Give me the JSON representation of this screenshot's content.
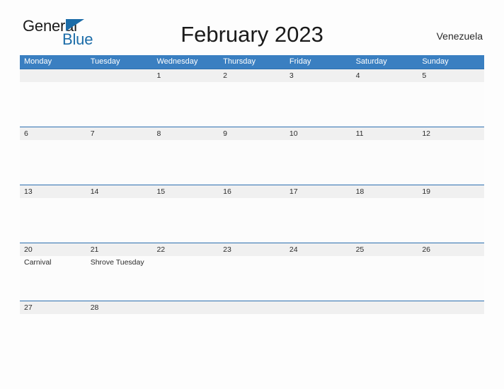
{
  "brand": {
    "name_part1": "General",
    "name_part2": "Blue",
    "flag_icon": "blue-triangle-flag-icon",
    "color_primary": "#1b6ca8"
  },
  "header": {
    "title": "February 2023",
    "country": "Venezuela"
  },
  "calendar": {
    "header_color": "#3a7fc1",
    "row_line_color": "#2c6fb0",
    "band_color": "#f0f0f0",
    "weekdays": [
      "Monday",
      "Tuesday",
      "Wednesday",
      "Thursday",
      "Friday",
      "Saturday",
      "Sunday"
    ],
    "weeks": [
      {
        "days": [
          {
            "number": "",
            "events": []
          },
          {
            "number": "",
            "events": []
          },
          {
            "number": "1",
            "events": []
          },
          {
            "number": "2",
            "events": []
          },
          {
            "number": "3",
            "events": []
          },
          {
            "number": "4",
            "events": []
          },
          {
            "number": "5",
            "events": []
          }
        ]
      },
      {
        "days": [
          {
            "number": "6",
            "events": []
          },
          {
            "number": "7",
            "events": []
          },
          {
            "number": "8",
            "events": []
          },
          {
            "number": "9",
            "events": []
          },
          {
            "number": "10",
            "events": []
          },
          {
            "number": "11",
            "events": []
          },
          {
            "number": "12",
            "events": []
          }
        ]
      },
      {
        "days": [
          {
            "number": "13",
            "events": []
          },
          {
            "number": "14",
            "events": []
          },
          {
            "number": "15",
            "events": []
          },
          {
            "number": "16",
            "events": []
          },
          {
            "number": "17",
            "events": []
          },
          {
            "number": "18",
            "events": []
          },
          {
            "number": "19",
            "events": []
          }
        ]
      },
      {
        "days": [
          {
            "number": "20",
            "events": [
              "Carnival"
            ]
          },
          {
            "number": "21",
            "events": [
              "Shrove Tuesday"
            ]
          },
          {
            "number": "22",
            "events": []
          },
          {
            "number": "23",
            "events": []
          },
          {
            "number": "24",
            "events": []
          },
          {
            "number": "25",
            "events": []
          },
          {
            "number": "26",
            "events": []
          }
        ]
      },
      {
        "days": [
          {
            "number": "27",
            "events": []
          },
          {
            "number": "28",
            "events": []
          },
          {
            "number": "",
            "events": []
          },
          {
            "number": "",
            "events": []
          },
          {
            "number": "",
            "events": []
          },
          {
            "number": "",
            "events": []
          },
          {
            "number": "",
            "events": []
          }
        ]
      }
    ]
  }
}
